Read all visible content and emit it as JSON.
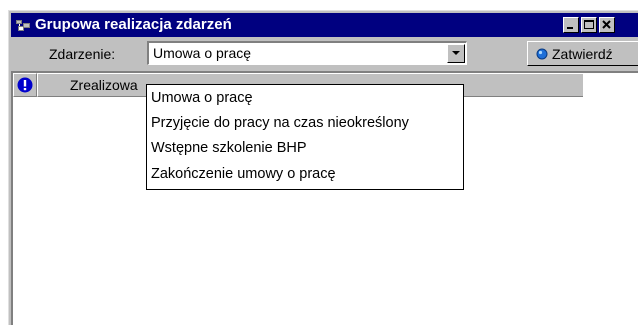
{
  "window": {
    "title": "Grupowa realizacja zdarzeń",
    "controls": {
      "minimize": "minimize-icon",
      "maximize": "maximize-icon",
      "close": "close-icon"
    }
  },
  "toolbar": {
    "event_label": "Zdarzenie:",
    "event_value": "Umowa o pracę",
    "confirm_label": "Zatwierdź",
    "confirm_icon": "blue-circle-icon"
  },
  "list": {
    "columns": [
      {
        "icon": "exclamation-icon"
      },
      {
        "label": "Zrealizowa"
      }
    ]
  },
  "dropdown": {
    "options": [
      "Umowa o pracę",
      "Przyjęcie do pracy na czas nieokreślony",
      "Wstępne szkolenie BHP",
      "Zakończenie umowy o pracę"
    ]
  },
  "colors": {
    "title_bar": "#000080",
    "face": "#c0c0c0",
    "info_icon": "#0000cc"
  }
}
